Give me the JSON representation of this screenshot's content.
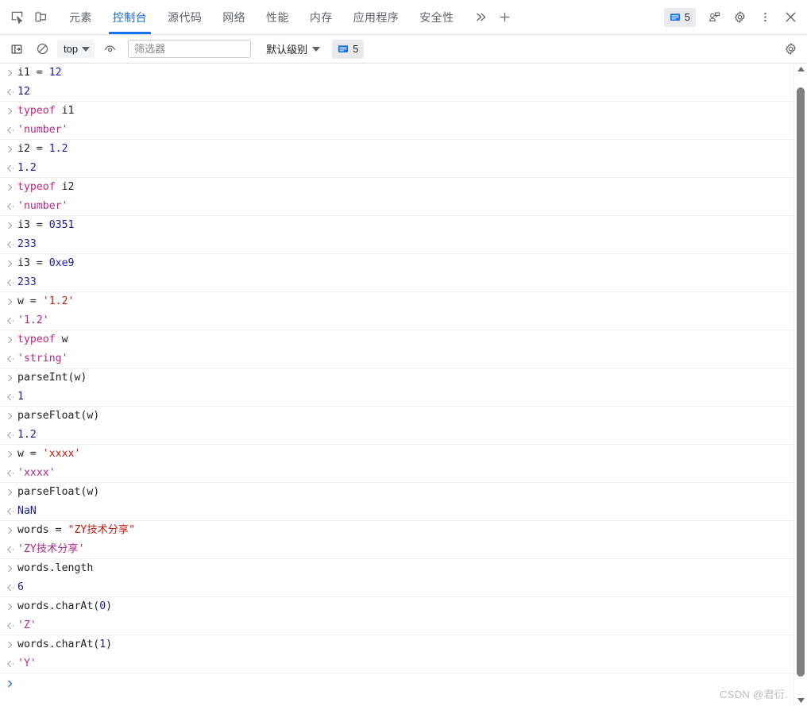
{
  "tabbar": {
    "inspect_icon": "inspect-element-icon",
    "device_icon": "device-toolbar-icon",
    "tabs": [
      {
        "label": "元素",
        "active": false
      },
      {
        "label": "控制台",
        "active": true
      },
      {
        "label": "源代码",
        "active": false
      },
      {
        "label": "网络",
        "active": false
      },
      {
        "label": "性能",
        "active": false
      },
      {
        "label": "内存",
        "active": false
      },
      {
        "label": "应用程序",
        "active": false
      },
      {
        "label": "安全性",
        "active": false
      }
    ],
    "more_tabs_icon": "chevron-double-right-icon",
    "add_tab_icon": "plus-icon",
    "message_count": "5",
    "feedback_icon": "feedback-icon",
    "settings_icon": "gear-icon",
    "menu_icon": "kebab-menu-icon",
    "close_icon": "close-icon"
  },
  "toolbar": {
    "sidebar_icon": "console-sidebar-icon",
    "clear_icon": "clear-console-icon",
    "context": "top",
    "eye_icon": "live-expression-icon",
    "filter_placeholder": "筛选器",
    "filter_value": "",
    "level_label": "默认级别",
    "message_count": "5",
    "settings_icon": "gear-icon"
  },
  "colors": {
    "accent": "#1a73e8",
    "active_tab_text": "#1967d2",
    "keyword": "#c5237d",
    "number": "#1a1aa6",
    "string_input": "#c41a16",
    "string_output": "#b4288f",
    "plain": "#202124",
    "gutter": "#9aa0a6",
    "prompt_active": "#1a73e8",
    "scrollbar_thumb": "#808080",
    "watermark": "#b9bcc0"
  },
  "console": {
    "input_marker": ">",
    "output_marker": "‹·",
    "entries": [
      {
        "input": [
          {
            "text": "i1 = ",
            "cls": "t-plain"
          },
          {
            "text": "12",
            "cls": "t-num"
          }
        ],
        "output": [
          {
            "text": "12",
            "cls": "t-num"
          }
        ]
      },
      {
        "input": [
          {
            "text": "typeof",
            "cls": "t-kw"
          },
          {
            "text": " i1",
            "cls": "t-plain"
          }
        ],
        "output": [
          {
            "text": "'number'",
            "cls": "t-str-out"
          }
        ]
      },
      {
        "input": [
          {
            "text": "i2 = ",
            "cls": "t-plain"
          },
          {
            "text": "1.2",
            "cls": "t-num"
          }
        ],
        "output": [
          {
            "text": "1.2",
            "cls": "t-num"
          }
        ]
      },
      {
        "input": [
          {
            "text": "typeof",
            "cls": "t-kw"
          },
          {
            "text": " i2",
            "cls": "t-plain"
          }
        ],
        "output": [
          {
            "text": "'number'",
            "cls": "t-str-out"
          }
        ]
      },
      {
        "input": [
          {
            "text": "i3 = ",
            "cls": "t-plain"
          },
          {
            "text": "0351",
            "cls": "t-num"
          }
        ],
        "output": [
          {
            "text": "233",
            "cls": "t-num"
          }
        ]
      },
      {
        "input": [
          {
            "text": "i3 = ",
            "cls": "t-plain"
          },
          {
            "text": "0xe9",
            "cls": "t-num"
          }
        ],
        "output": [
          {
            "text": "233",
            "cls": "t-num"
          }
        ]
      },
      {
        "input": [
          {
            "text": "w = ",
            "cls": "t-plain"
          },
          {
            "text": "'1.2'",
            "cls": "t-str-in"
          }
        ],
        "output": [
          {
            "text": "'1.2'",
            "cls": "t-str-out"
          }
        ]
      },
      {
        "input": [
          {
            "text": "typeof",
            "cls": "t-kw"
          },
          {
            "text": " w",
            "cls": "t-plain"
          }
        ],
        "output": [
          {
            "text": "'string'",
            "cls": "t-str-out"
          }
        ]
      },
      {
        "input": [
          {
            "text": "parseInt(w)",
            "cls": "t-plain"
          }
        ],
        "output": [
          {
            "text": "1",
            "cls": "t-num"
          }
        ]
      },
      {
        "input": [
          {
            "text": "parseFloat(w)",
            "cls": "t-plain"
          }
        ],
        "output": [
          {
            "text": "1.2",
            "cls": "t-num"
          }
        ]
      },
      {
        "input": [
          {
            "text": "w = ",
            "cls": "t-plain"
          },
          {
            "text": "'xxxx'",
            "cls": "t-str-in"
          }
        ],
        "output": [
          {
            "text": "'xxxx'",
            "cls": "t-str-out"
          }
        ]
      },
      {
        "input": [
          {
            "text": "parseFloat(w)",
            "cls": "t-plain"
          }
        ],
        "output": [
          {
            "text": "NaN",
            "cls": "t-num"
          }
        ]
      },
      {
        "input": [
          {
            "text": "words = ",
            "cls": "t-plain"
          },
          {
            "text": "\"ZY技术分享\"",
            "cls": "t-str-in"
          }
        ],
        "output": [
          {
            "text": "'ZY技术分享'",
            "cls": "t-str-out"
          }
        ]
      },
      {
        "input": [
          {
            "text": "words.length",
            "cls": "t-plain"
          }
        ],
        "output": [
          {
            "text": "6",
            "cls": "t-num"
          }
        ]
      },
      {
        "input": [
          {
            "text": "words.charAt(",
            "cls": "t-plain"
          },
          {
            "text": "0",
            "cls": "t-num"
          },
          {
            "text": ")",
            "cls": "t-plain"
          }
        ],
        "output": [
          {
            "text": "'Z'",
            "cls": "t-str-out"
          }
        ]
      },
      {
        "input": [
          {
            "text": "words.charAt(",
            "cls": "t-plain"
          },
          {
            "text": "1",
            "cls": "t-num"
          },
          {
            "text": ")",
            "cls": "t-plain"
          }
        ],
        "output": [
          {
            "text": "'Y'",
            "cls": "t-str-out"
          }
        ]
      }
    ],
    "prompt_value": ""
  },
  "scrollbar": {
    "up_icon": "scroll-up-arrow-icon",
    "down_icon": "scroll-down-arrow-icon",
    "thumb_top_pct": 2,
    "thumb_height_pct": 95
  },
  "watermark": {
    "text": "CSDN @君衍."
  }
}
